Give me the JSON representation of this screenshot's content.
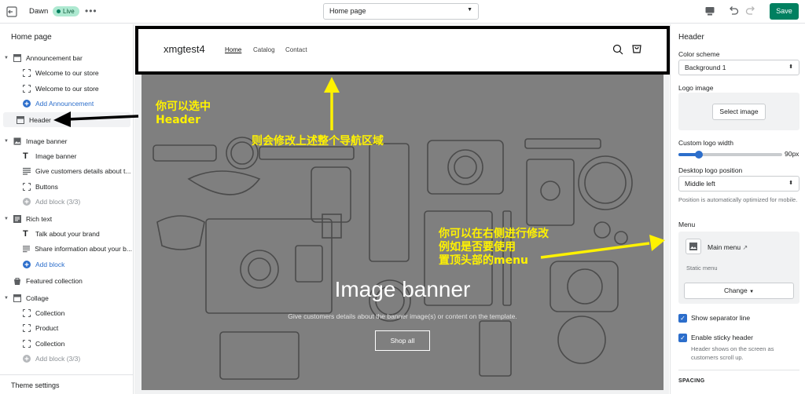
{
  "topbar": {
    "theme_name": "Dawn",
    "live_badge": "Live",
    "more": "•••",
    "page_select": "Home page",
    "save_label": "Save"
  },
  "sidebar": {
    "title": "Home page",
    "items": [
      {
        "label": "Announcement bar",
        "icon": "announcement-bar-icon"
      },
      {
        "label": "Welcome to our store",
        "icon": "block-icon"
      },
      {
        "label": "Welcome to our store",
        "icon": "block-icon"
      },
      {
        "label": "Add Announcement",
        "icon": "plus-circle-icon"
      },
      {
        "label": "Header",
        "icon": "header-icon"
      },
      {
        "label": "Image banner",
        "icon": "image-icon"
      },
      {
        "label": "Image banner",
        "icon": "text-icon"
      },
      {
        "label": "Give customers details about t...",
        "icon": "text-icon"
      },
      {
        "label": "Buttons",
        "icon": "block-icon"
      },
      {
        "label": "Add block (3/3)",
        "icon": "plus-circle-icon"
      },
      {
        "label": "Rich text",
        "icon": "rich-text-icon"
      },
      {
        "label": "Talk about your brand",
        "icon": "text-icon"
      },
      {
        "label": "Share information about your b...",
        "icon": "text-icon"
      },
      {
        "label": "Add block",
        "icon": "plus-circle-icon"
      },
      {
        "label": "Featured collection",
        "icon": "collection-icon"
      },
      {
        "label": "Collage",
        "icon": "collage-icon"
      },
      {
        "label": "Collection",
        "icon": "block-icon"
      },
      {
        "label": "Product",
        "icon": "block-icon"
      },
      {
        "label": "Collection",
        "icon": "block-icon"
      },
      {
        "label": "Add block (3/3)",
        "icon": "plus-circle-icon"
      }
    ],
    "theme_settings": "Theme settings"
  },
  "preview": {
    "store_name": "xmgtest4",
    "nav": [
      "Home",
      "Catalog",
      "Contact"
    ],
    "banner_title": "Image banner",
    "banner_subtitle": "Give customers details about the banner image(s) or content on the template.",
    "shop_all": "Shop all"
  },
  "annotations": {
    "select_header_line1": "你可以选中",
    "select_header_line2": "Header",
    "modify_nav": "则会修改上述整个导航区域",
    "right_edit_line1": "你可以在右侧进行修改",
    "right_edit_line2": "例如是否要使用",
    "right_edit_line3": "置顶头部的menu"
  },
  "rpanel": {
    "title": "Header",
    "color_scheme_label": "Color scheme",
    "color_scheme_value": "Background 1",
    "logo_image_label": "Logo image",
    "select_image": "Select image",
    "custom_logo_width_label": "Custom logo width",
    "logo_width_value": "90px",
    "logo_width_fraction": 0.2,
    "desktop_logo_position_label": "Desktop logo position",
    "desktop_logo_position_value": "Middle left",
    "position_help": "Position is automatically optimized for mobile.",
    "menu_label": "Menu",
    "menu_name": "Main menu",
    "static_menu": "Static menu",
    "change_label": "Change",
    "show_separator_line": "Show separator line",
    "enable_sticky_header": "Enable sticky header",
    "sticky_help": "Header shows on the screen as customers scroll up.",
    "spacing": "SPACING"
  },
  "colors": {
    "save_green": "#008060",
    "link_blue": "#2c6ecb",
    "annotation_yellow": "#fff200"
  }
}
